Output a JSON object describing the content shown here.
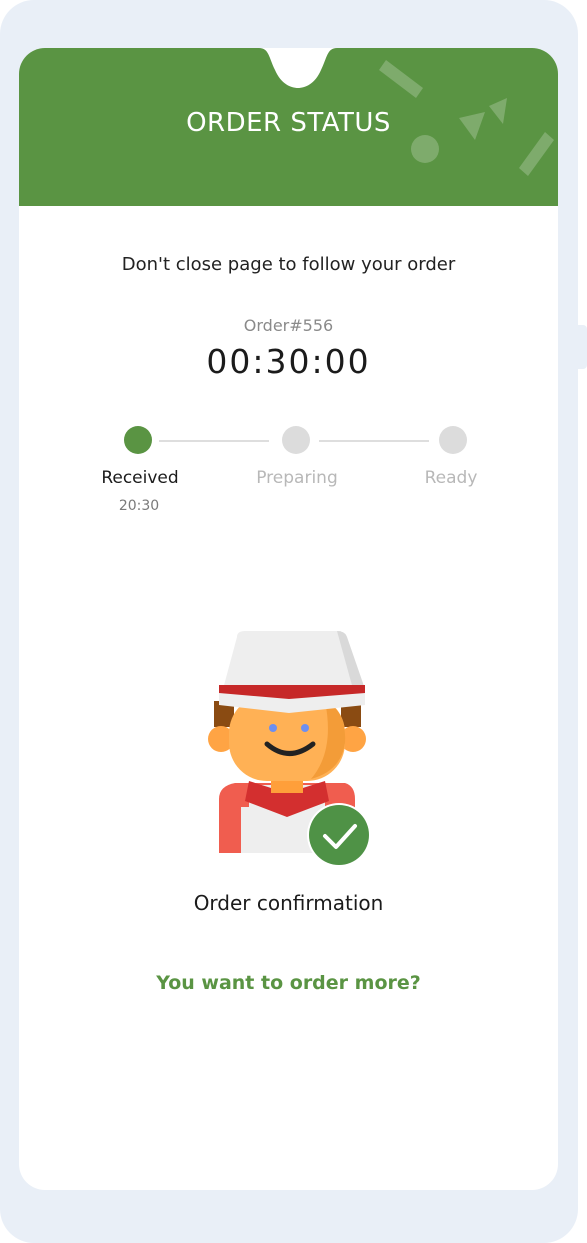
{
  "header": {
    "title": "ORDER STATUS",
    "accent": "#5a9443"
  },
  "main": {
    "subtitle": "Don't close page to follow your order",
    "order_number": "Order#556",
    "timer": "00:30:00"
  },
  "steps": [
    {
      "label": "Received",
      "time": "20:30",
      "state": "active"
    },
    {
      "label": "Preparing",
      "time": "",
      "state": "pending"
    },
    {
      "label": "Ready",
      "time": "",
      "state": "pending"
    }
  ],
  "illustration": {
    "icon": "chef-icon",
    "badge_icon": "check-icon"
  },
  "status_text": "Order confirmation",
  "order_more_link": "You want to order more?"
}
